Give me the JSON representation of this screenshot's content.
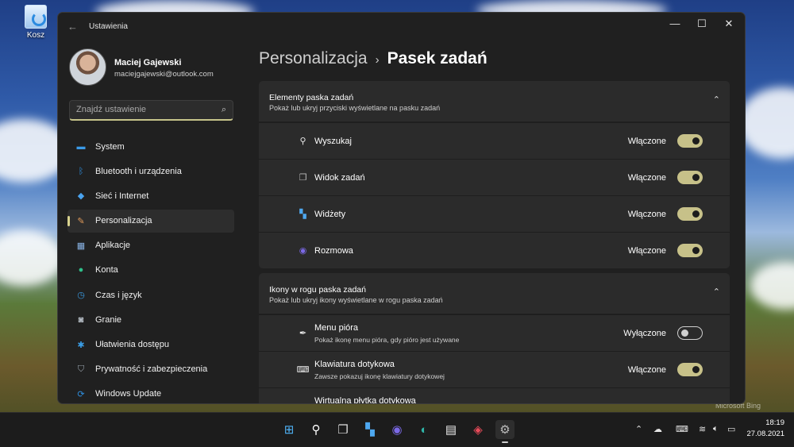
{
  "desktop": {
    "recycle_bin": "Kosz",
    "watermark": "Microsoft Bing"
  },
  "window": {
    "title": "Ustawienia",
    "back": "←",
    "minimize": "—",
    "maximize": "☐",
    "close": "✕"
  },
  "profile": {
    "name": "Maciej Gajewski",
    "email": "maciejgajewski@outlook.com"
  },
  "search": {
    "placeholder": "Znajdź ustawienie",
    "icon": "⌕"
  },
  "nav": [
    {
      "label": "System",
      "icon": "monitor-icon",
      "color": "#3b9ae8"
    },
    {
      "label": "Bluetooth i urządzenia",
      "icon": "bluetooth-icon",
      "color": "#2e8fe0"
    },
    {
      "label": "Sieć i Internet",
      "icon": "wifi-icon",
      "color": "#4aa3ef"
    },
    {
      "label": "Personalizacja",
      "icon": "brush-icon",
      "color": "#e29b5a",
      "active": true
    },
    {
      "label": "Aplikacje",
      "icon": "apps-icon",
      "color": "#8ab4e6"
    },
    {
      "label": "Konta",
      "icon": "person-icon",
      "color": "#2fbf8a"
    },
    {
      "label": "Czas i język",
      "icon": "globe-clock-icon",
      "color": "#3a9de6"
    },
    {
      "label": "Granie",
      "icon": "gamepad-icon",
      "color": "#b8c0c8"
    },
    {
      "label": "Ułatwienia dostępu",
      "icon": "accessibility-icon",
      "color": "#3a9de6"
    },
    {
      "label": "Prywatność i zabezpieczenia",
      "icon": "shield-icon",
      "color": "#9aa4ae"
    },
    {
      "label": "Windows Update",
      "icon": "update-icon",
      "color": "#2e8fe0"
    }
  ],
  "breadcrumb": {
    "parent": "Personalizacja",
    "separator": "›",
    "current": "Pasek zadań"
  },
  "groups": [
    {
      "title": "Elementy paska zadań",
      "subtitle": "Pokaż lub ukryj przyciski wyświetlane na pasku zadań",
      "rows": [
        {
          "label": "Wyszukaj",
          "state": "Włączone",
          "on": true
        },
        {
          "label": "Widok zadań",
          "state": "Włączone",
          "on": true
        },
        {
          "label": "Widżety",
          "state": "Włączone",
          "on": true
        },
        {
          "label": "Rozmowa",
          "state": "Włączone",
          "on": true
        }
      ]
    },
    {
      "title": "Ikony w rogu paska zadań",
      "subtitle": "Pokaż lub ukryj ikony wyświetlane w rogu paska zadań",
      "rows": [
        {
          "label": "Menu pióra",
          "sub": "Pokaż ikonę menu pióra, gdy pióro jest używane",
          "state": "Wyłączone",
          "on": false
        },
        {
          "label": "Klawiatura dotykowa",
          "sub": "Zawsze pokazuj ikonę klawiatury dotykowej",
          "state": "Włączone",
          "on": true
        },
        {
          "label": "Wirtualna płytka dotykowa",
          "sub": "",
          "state": "",
          "on": false
        }
      ]
    }
  ],
  "taskbar": {
    "apps": [
      "start-icon",
      "search-icon",
      "task-view-icon",
      "widgets-icon",
      "teams-chat-icon",
      "edge-canary-icon",
      "store-icon",
      "office-icon",
      "settings-icon"
    ],
    "time": "18:19",
    "date": "27.08.2021"
  }
}
